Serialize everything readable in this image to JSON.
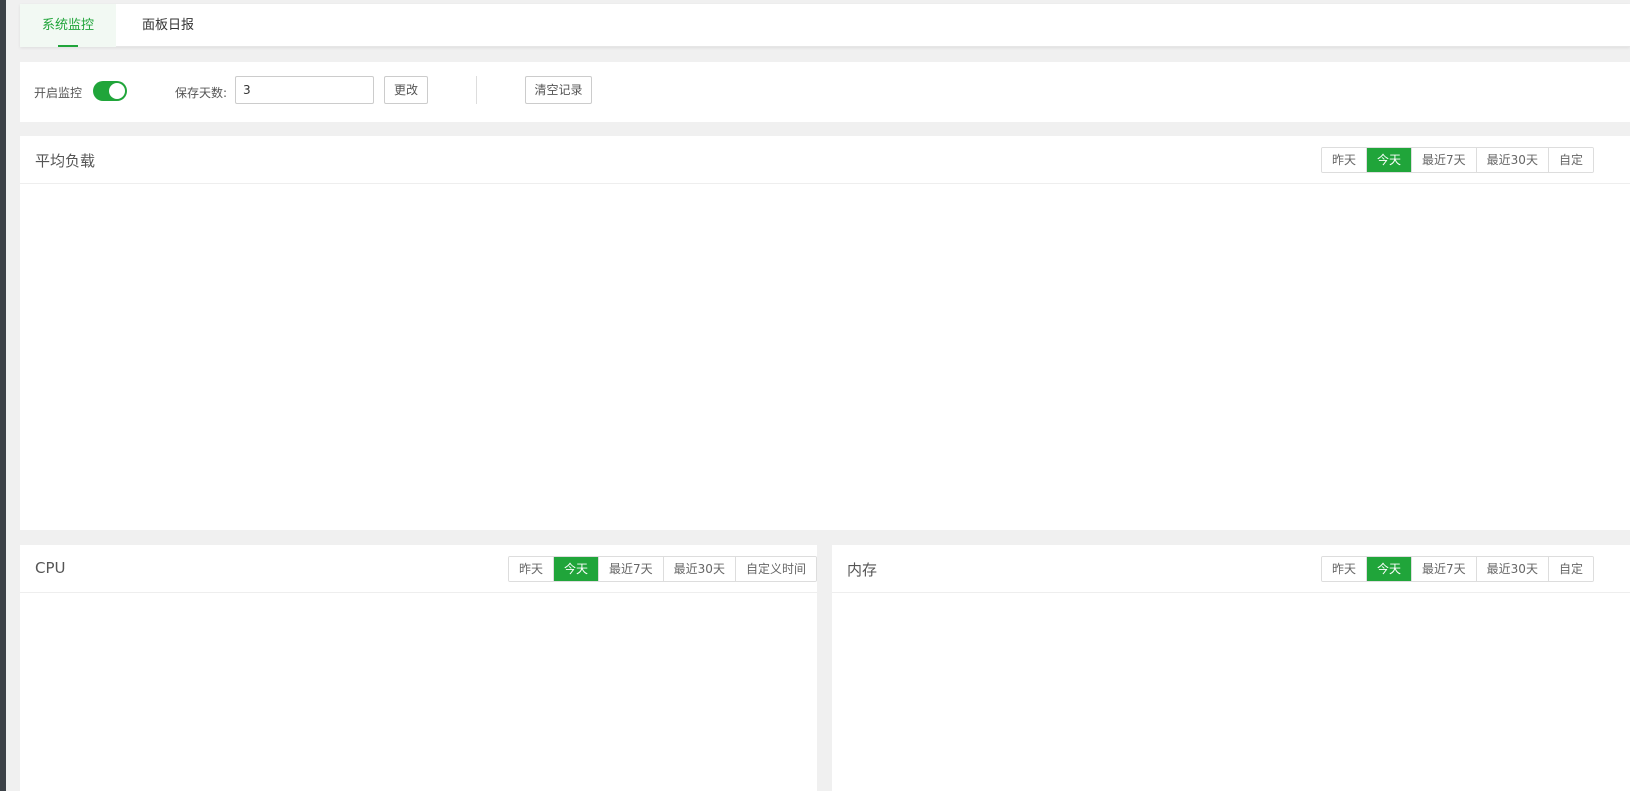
{
  "tabs": [
    {
      "label": "系统监控",
      "active": true
    },
    {
      "label": "面板日报",
      "active": false
    }
  ],
  "controls": {
    "monitor_label": "开启监控",
    "monitor_enabled": true,
    "days_label": "保存天数:",
    "days_value": "3",
    "change_button": "更改",
    "clear_button": "清空记录"
  },
  "accent_color": "#20a53a",
  "panels": {
    "load": {
      "title": "平均负载",
      "ranges": [
        "昨天",
        "今天",
        "最近7天",
        "最近30天",
        "自定"
      ],
      "active_range": "今天"
    },
    "cpu": {
      "title": "CPU",
      "ranges": [
        "昨天",
        "今天",
        "最近7天",
        "最近30天",
        "自定义时间"
      ],
      "active_range": "今天"
    },
    "memory": {
      "title": "内存",
      "ranges": [
        "昨天",
        "今天",
        "最近7天",
        "最近30天",
        "自定"
      ],
      "active_range": "今天"
    }
  }
}
